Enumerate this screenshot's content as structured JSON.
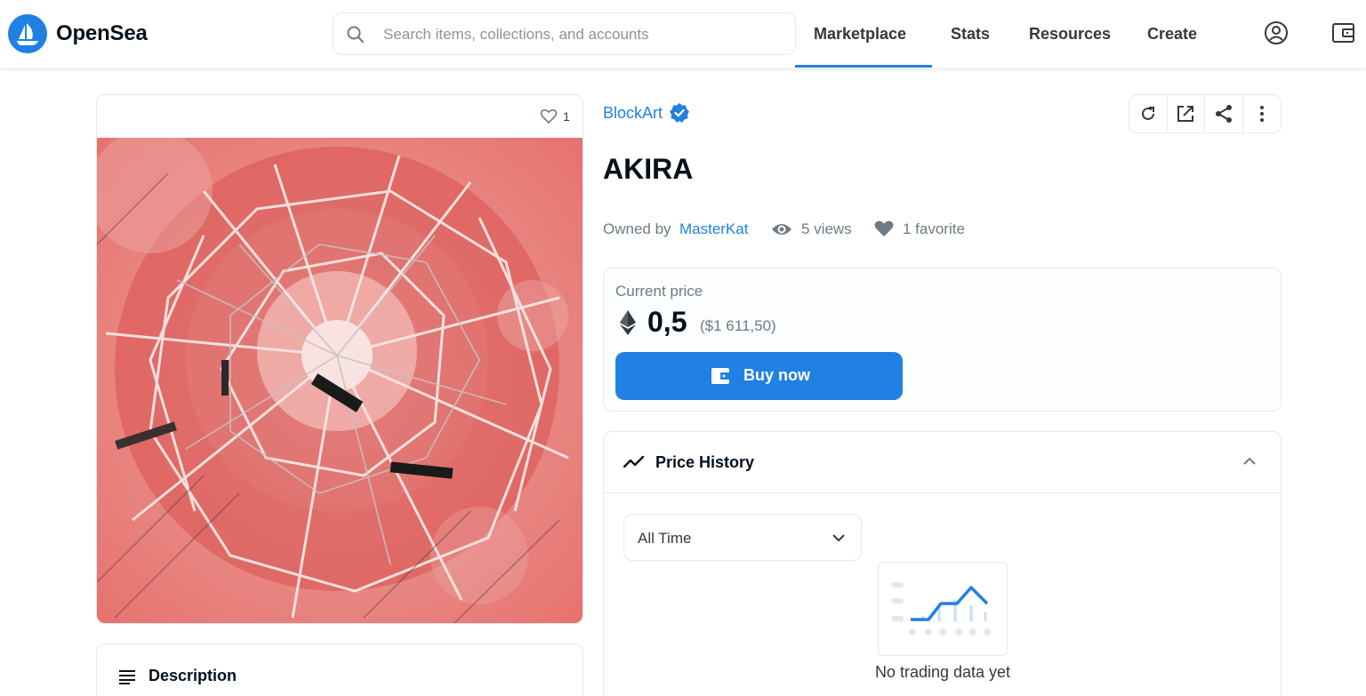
{
  "header": {
    "brand": "OpenSea",
    "search_placeholder": "Search items, collections, and accounts",
    "nav": {
      "marketplace": "Marketplace",
      "stats": "Stats",
      "resources": "Resources",
      "create": "Create"
    },
    "active_nav": "Marketplace",
    "icons": [
      "account-icon",
      "wallet-icon"
    ]
  },
  "asset": {
    "favorites_badge": "1",
    "collection": "BlockArt",
    "title": "AKIRA",
    "owned_by_label": "Owned by",
    "owner": "MasterKat",
    "views": "5 views",
    "favorites": "1 favorite",
    "description_title": "Description",
    "actions": [
      "refresh-icon",
      "external-link-icon",
      "share-icon",
      "more-icon"
    ]
  },
  "price": {
    "label": "Current price",
    "value": "0,5",
    "usd": "($1 611,50)",
    "buy_label": "Buy now"
  },
  "price_history": {
    "title": "Price History",
    "range": "All Time",
    "empty_text": "No trading data yet"
  },
  "colors": {
    "accent": "#2081e2",
    "text": "#353840",
    "muted": "#707a83",
    "border": "#e5e8eb"
  }
}
